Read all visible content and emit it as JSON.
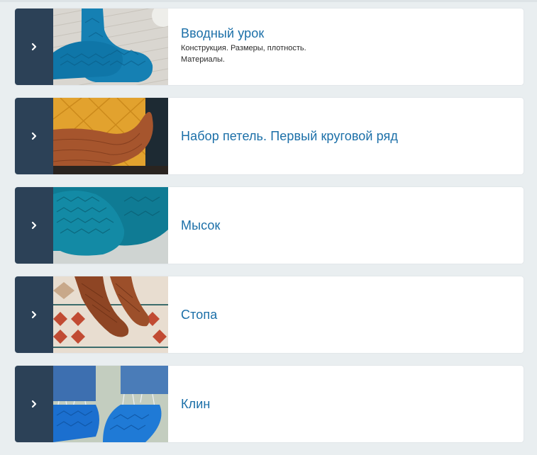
{
  "lessons": [
    {
      "title": "Вводный урок",
      "description": "Конструкция. Размеры, плотность.\nМатериалы.",
      "icon": "chevron-right-icon",
      "image": "blue-socks-on-wooden-floor"
    },
    {
      "title": "Набор петель. Первый круговой ряд",
      "description": "",
      "icon": "chevron-right-icon",
      "image": "brown-sock-on-yellow-chair"
    },
    {
      "title": "Мысок",
      "description": "",
      "icon": "chevron-right-icon",
      "image": "teal-socks-closeup"
    },
    {
      "title": "Стопа",
      "description": "",
      "icon": "chevron-right-icon",
      "image": "brown-socks-on-patterned-rug"
    },
    {
      "title": "Клин",
      "description": "",
      "icon": "chevron-right-icon",
      "image": "blue-socks-with-jeans"
    }
  ],
  "colors": {
    "accent": "#1b6fa8",
    "toggle_bg": "#2c4157",
    "page_bg": "#e9eef0"
  }
}
